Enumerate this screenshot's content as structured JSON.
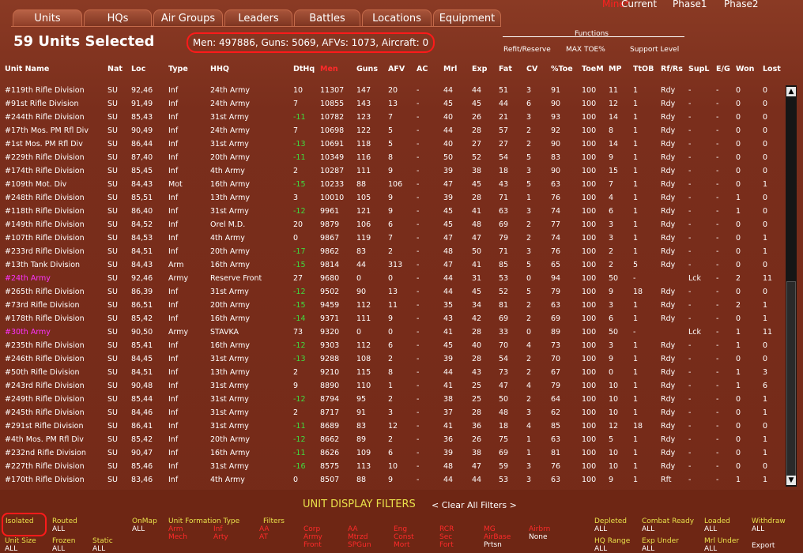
{
  "tabs": [
    "Units",
    "HQs",
    "Air Groups",
    "Leaders",
    "Battles",
    "Locations",
    "Equipment"
  ],
  "top_right": {
    "mine": "Mine*",
    "current": "Current",
    "phase1": "Phase1",
    "phase2": "Phase2"
  },
  "header": {
    "title": "59 Units Selected",
    "summary": "Men: 497886, Guns: 5069, AFVs: 1073, Aircraft: 0",
    "functions_label": "Functions",
    "functions": [
      "Refit/Reserve",
      "MAX TOE%",
      "Support Level"
    ]
  },
  "columns": [
    "Unit Name",
    "Nat",
    "Loc",
    "Type",
    "HHQ",
    "DtHq",
    "Men",
    "Guns",
    "AFV",
    "AC",
    "Mrl",
    "Exp",
    "Fat",
    "CV",
    "%Toe",
    "ToeM",
    "MP",
    "TtOB",
    "Rf/Rs",
    "SupL",
    "E/G",
    "Won",
    "Lost"
  ],
  "rows": [
    [
      "#119th Rifle Division",
      "SU",
      "92,46",
      "Inf",
      "24th Army",
      "10",
      "11307",
      "147",
      "20",
      "-",
      "44",
      "44",
      "51",
      "3",
      "91",
      "100",
      "11",
      "1",
      "Rdy",
      "-",
      "-",
      "0",
      "0"
    ],
    [
      "#91st Rifle Division",
      "SU",
      "91,49",
      "Inf",
      "24th Army",
      "7",
      "10855",
      "143",
      "13",
      "-",
      "45",
      "45",
      "44",
      "6",
      "90",
      "100",
      "12",
      "1",
      "Rdy",
      "-",
      "-",
      "0",
      "0"
    ],
    [
      "#244th Rifle Division",
      "SU",
      "85,43",
      "Inf",
      "31st Army",
      "-11",
      "10782",
      "123",
      "7",
      "-",
      "40",
      "26",
      "21",
      "3",
      "93",
      "100",
      "14",
      "1",
      "Rdy",
      "-",
      "-",
      "0",
      "0"
    ],
    [
      "#17th Mos. PM Rfl Div",
      "SU",
      "90,49",
      "Inf",
      "24th Army",
      "7",
      "10698",
      "122",
      "5",
      "-",
      "44",
      "28",
      "57",
      "2",
      "92",
      "100",
      "8",
      "1",
      "Rdy",
      "-",
      "-",
      "0",
      "0"
    ],
    [
      "#1st Mos. PM Rfl Div",
      "SU",
      "86,44",
      "Inf",
      "31st Army",
      "-13",
      "10691",
      "118",
      "5",
      "-",
      "40",
      "27",
      "27",
      "2",
      "90",
      "100",
      "14",
      "1",
      "Rdy",
      "-",
      "-",
      "0",
      "0"
    ],
    [
      "#229th Rifle Division",
      "SU",
      "87,40",
      "Inf",
      "20th Army",
      "-11",
      "10349",
      "116",
      "8",
      "-",
      "50",
      "52",
      "54",
      "5",
      "83",
      "100",
      "9",
      "1",
      "Rdy",
      "-",
      "-",
      "0",
      "0"
    ],
    [
      "#174th Rifle Division",
      "SU",
      "85,45",
      "Inf",
      "4th Army",
      "2",
      "10287",
      "111",
      "9",
      "-",
      "39",
      "38",
      "18",
      "3",
      "90",
      "100",
      "15",
      "1",
      "Rdy",
      "-",
      "-",
      "0",
      "0"
    ],
    [
      "#109th Mot. Div",
      "SU",
      "84,43",
      "Mot",
      "16th Army",
      "-15",
      "10233",
      "88",
      "106",
      "-",
      "47",
      "45",
      "43",
      "5",
      "63",
      "100",
      "7",
      "1",
      "Rdy",
      "-",
      "-",
      "0",
      "1"
    ],
    [
      "#248th Rifle Division",
      "SU",
      "85,51",
      "Inf",
      "13th Army",
      "3",
      "10010",
      "105",
      "9",
      "-",
      "39",
      "28",
      "71",
      "1",
      "76",
      "100",
      "4",
      "1",
      "Rdy",
      "-",
      "-",
      "1",
      "0"
    ],
    [
      "#118th Rifle Division",
      "SU",
      "86,40",
      "Inf",
      "31st Army",
      "-12",
      "9961",
      "121",
      "9",
      "-",
      "45",
      "41",
      "63",
      "3",
      "74",
      "100",
      "6",
      "1",
      "Rdy",
      "-",
      "-",
      "1",
      "0"
    ],
    [
      "#149th Rifle Division",
      "SU",
      "84,52",
      "Inf",
      "Orel M.D.",
      "20",
      "9879",
      "106",
      "6",
      "-",
      "45",
      "48",
      "69",
      "2",
      "77",
      "100",
      "3",
      "1",
      "Rdy",
      "-",
      "-",
      "0",
      "0"
    ],
    [
      "#107th Rifle Division",
      "SU",
      "84,53",
      "Inf",
      "4th Army",
      "0",
      "9867",
      "119",
      "7",
      "-",
      "47",
      "47",
      "79",
      "2",
      "74",
      "100",
      "3",
      "1",
      "Rdy",
      "-",
      "-",
      "0",
      "1"
    ],
    [
      "#233rd Rifle Division",
      "SU",
      "84,51",
      "Inf",
      "20th Army",
      "-17",
      "9862",
      "83",
      "2",
      "-",
      "48",
      "50",
      "71",
      "3",
      "76",
      "100",
      "2",
      "1",
      "Rdy",
      "-",
      "-",
      "0",
      "1"
    ],
    [
      "#13th Tank Division",
      "SU",
      "84,43",
      "Arm",
      "16th Army",
      "-15",
      "9814",
      "44",
      "313",
      "-",
      "47",
      "41",
      "85",
      "5",
      "65",
      "100",
      "2",
      "5",
      "Rdy",
      "-",
      "-",
      "0",
      "0"
    ],
    [
      "#24th Army",
      "SU",
      "92,46",
      "Army",
      "Reserve Front",
      "27",
      "9680",
      "0",
      "0",
      "-",
      "44",
      "31",
      "53",
      "0",
      "94",
      "100",
      "50",
      "-",
      "",
      "Lck",
      "-",
      "2",
      "11"
    ],
    [
      "#265th Rifle Division",
      "SU",
      "86,39",
      "Inf",
      "31st Army",
      "-12",
      "9502",
      "90",
      "13",
      "-",
      "44",
      "45",
      "52",
      "5",
      "79",
      "100",
      "9",
      "18",
      "Rdy",
      "-",
      "-",
      "0",
      "0"
    ],
    [
      "#73rd Rifle Division",
      "SU",
      "86,51",
      "Inf",
      "20th Army",
      "-15",
      "9459",
      "112",
      "11",
      "-",
      "35",
      "34",
      "81",
      "2",
      "63",
      "100",
      "3",
      "1",
      "Rdy",
      "-",
      "-",
      "2",
      "1"
    ],
    [
      "#178th Rifle Division",
      "SU",
      "85,42",
      "Inf",
      "16th Army",
      "-14",
      "9371",
      "111",
      "9",
      "-",
      "43",
      "42",
      "69",
      "2",
      "69",
      "100",
      "6",
      "1",
      "Rdy",
      "-",
      "-",
      "0",
      "1"
    ],
    [
      "#30th Army",
      "SU",
      "90,50",
      "Army",
      "STAVKA",
      "73",
      "9320",
      "0",
      "0",
      "-",
      "41",
      "28",
      "33",
      "0",
      "89",
      "100",
      "50",
      "-",
      "",
      "Lck",
      "-",
      "1",
      "11"
    ],
    [
      "#235th Rifle Division",
      "SU",
      "85,41",
      "Inf",
      "16th Army",
      "-12",
      "9303",
      "112",
      "6",
      "-",
      "45",
      "40",
      "70",
      "4",
      "73",
      "100",
      "3",
      "1",
      "Rdy",
      "-",
      "-",
      "1",
      "0"
    ],
    [
      "#246th Rifle Division",
      "SU",
      "84,45",
      "Inf",
      "31st Army",
      "-13",
      "9288",
      "108",
      "2",
      "-",
      "39",
      "28",
      "54",
      "2",
      "70",
      "100",
      "9",
      "1",
      "Rdy",
      "-",
      "-",
      "0",
      "0"
    ],
    [
      "#50th Rifle Division",
      "SU",
      "84,51",
      "Inf",
      "13th Army",
      "2",
      "9210",
      "115",
      "8",
      "-",
      "44",
      "43",
      "73",
      "2",
      "67",
      "100",
      "0",
      "1",
      "Rdy",
      "-",
      "-",
      "1",
      "3"
    ],
    [
      "#243rd Rifle Division",
      "SU",
      "90,48",
      "Inf",
      "31st Army",
      "9",
      "8890",
      "110",
      "1",
      "-",
      "41",
      "25",
      "47",
      "4",
      "79",
      "100",
      "10",
      "1",
      "Rdy",
      "-",
      "-",
      "1",
      "6"
    ],
    [
      "#249th Rifle Division",
      "SU",
      "85,44",
      "Inf",
      "31st Army",
      "-12",
      "8794",
      "95",
      "2",
      "-",
      "38",
      "25",
      "50",
      "2",
      "64",
      "100",
      "10",
      "1",
      "Rdy",
      "-",
      "-",
      "0",
      "1"
    ],
    [
      "#245th Rifle Division",
      "SU",
      "84,46",
      "Inf",
      "31st Army",
      "2",
      "8717",
      "91",
      "3",
      "-",
      "37",
      "28",
      "48",
      "3",
      "62",
      "100",
      "10",
      "1",
      "Rdy",
      "-",
      "-",
      "0",
      "1"
    ],
    [
      "#291st Rifle Division",
      "SU",
      "86,41",
      "Inf",
      "31st Army",
      "-11",
      "8689",
      "83",
      "12",
      "-",
      "41",
      "36",
      "18",
      "4",
      "85",
      "100",
      "12",
      "18",
      "Rdy",
      "-",
      "-",
      "0",
      "0"
    ],
    [
      "#4th Mos. PM Rfl Div",
      "SU",
      "85,42",
      "Inf",
      "20th Army",
      "-12",
      "8662",
      "89",
      "2",
      "-",
      "36",
      "26",
      "75",
      "1",
      "63",
      "100",
      "5",
      "1",
      "Rdy",
      "-",
      "-",
      "0",
      "1"
    ],
    [
      "#232nd Rifle Division",
      "SU",
      "90,47",
      "Inf",
      "16th Army",
      "-11",
      "8626",
      "109",
      "6",
      "-",
      "39",
      "38",
      "69",
      "1",
      "81",
      "100",
      "10",
      "1",
      "Rdy",
      "-",
      "-",
      "0",
      "1"
    ],
    [
      "#227th Rifle Division",
      "SU",
      "85,46",
      "Inf",
      "31st Army",
      "-16",
      "8575",
      "113",
      "10",
      "-",
      "48",
      "47",
      "59",
      "3",
      "76",
      "100",
      "10",
      "1",
      "Rdy",
      "-",
      "-",
      "0",
      "0"
    ],
    [
      "#170th Rifle Division",
      "SU",
      "83,46",
      "Inf",
      "4th Army",
      "0",
      "8507",
      "88",
      "9",
      "-",
      "44",
      "44",
      "53",
      "3",
      "63",
      "100",
      "9",
      "1",
      "Rft",
      "-",
      "-",
      "1",
      "1"
    ]
  ],
  "hq_rows": [
    14,
    18
  ],
  "filters": {
    "title": "UNIT DISPLAY FILTERS",
    "clear_all": "< Clear All Filters >",
    "isolated": "Isolated",
    "routed": "Routed",
    "routed_val": "ALL",
    "unit_size": "Unit Size",
    "unit_size_val": "ALL",
    "frozen": "Frozen",
    "frozen_val": "ALL",
    "static": "Static",
    "static_val": "ALL",
    "onmap": "OnMap",
    "onmap_val": "ALL",
    "unit_formation_type": "Unit Formation Type",
    "filters_label": "Filters",
    "red_opts": [
      [
        "Arm",
        "Mech"
      ],
      [
        "Inf",
        "Arty"
      ],
      [
        "AA",
        "AT"
      ],
      [
        "Corp",
        "Army",
        "Front"
      ],
      [
        "AA",
        "Mtrzd",
        "SPGun"
      ],
      [
        "Eng",
        "Const",
        "Mort"
      ],
      [
        "RCR",
        "Sec",
        "Fort"
      ],
      [
        "MG",
        "AirBase",
        "Prtsn"
      ],
      [
        "Airbrn",
        "None"
      ]
    ],
    "right": [
      [
        "Depleted",
        "ALL"
      ],
      [
        "Combat Ready",
        "ALL"
      ],
      [
        "Loaded",
        "ALL"
      ],
      [
        "Withdraw",
        "ALL"
      ],
      [
        "HQ Range",
        "ALL"
      ],
      [
        "Exp Under",
        "ALL"
      ],
      [
        "Mrl Under",
        "ALL"
      ],
      [
        "Export",
        ""
      ]
    ]
  },
  "colors": {
    "background": "#7a2e1c",
    "highlight_red": "#ff1a1a",
    "hq_magenta": "#ff33ff",
    "positive_green": "#3fdc3f",
    "filter_yellow": "#e8e04a"
  }
}
